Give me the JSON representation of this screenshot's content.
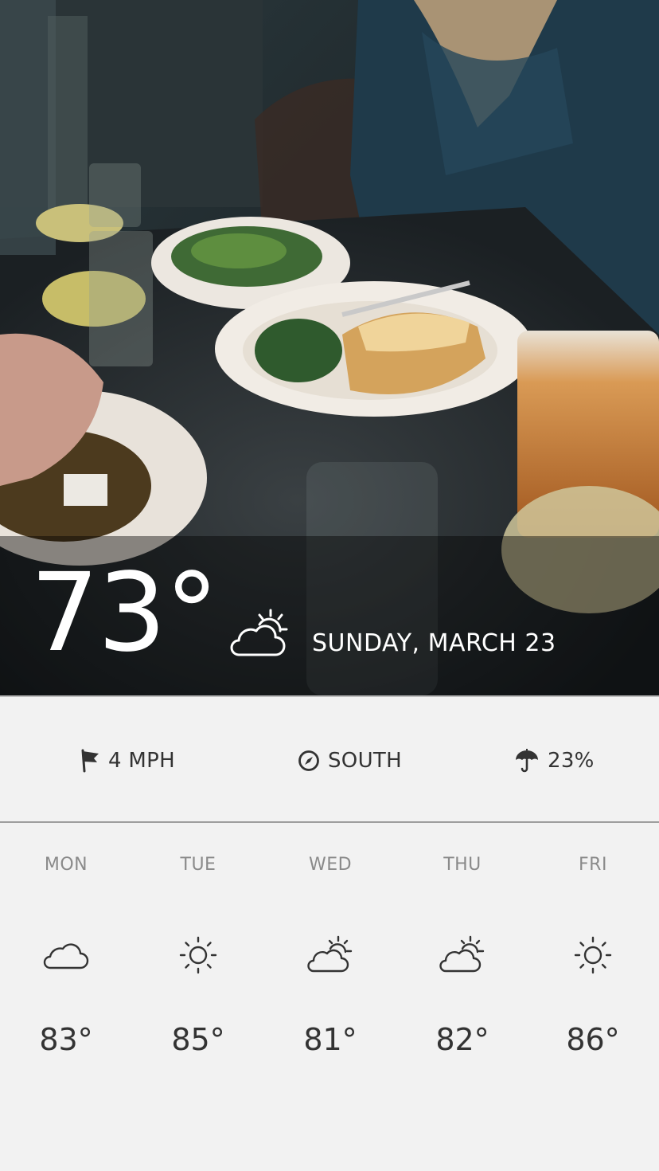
{
  "current": {
    "temperature": "73°",
    "condition_icon": "partly-cloudy-icon",
    "date": "SUNDAY, MARCH 23"
  },
  "stats": {
    "wind_speed": "4 MPH",
    "wind_icon": "flag-icon",
    "wind_direction": "SOUTH",
    "direction_icon": "compass-icon",
    "precipitation": "23%",
    "precipitation_icon": "umbrella-icon"
  },
  "forecast": [
    {
      "day": "MON",
      "icon": "cloud-icon",
      "temp": "83°"
    },
    {
      "day": "TUE",
      "icon": "sun-icon",
      "temp": "85°"
    },
    {
      "day": "WED",
      "icon": "partly-cloudy-icon",
      "temp": "81°"
    },
    {
      "day": "THU",
      "icon": "partly-cloudy-icon",
      "temp": "82°"
    },
    {
      "day": "FRI",
      "icon": "sun-icon",
      "temp": "86°"
    }
  ],
  "colors": {
    "text_dark": "#333333",
    "text_muted": "#8a8a8a",
    "background": "#f2f2f2"
  }
}
